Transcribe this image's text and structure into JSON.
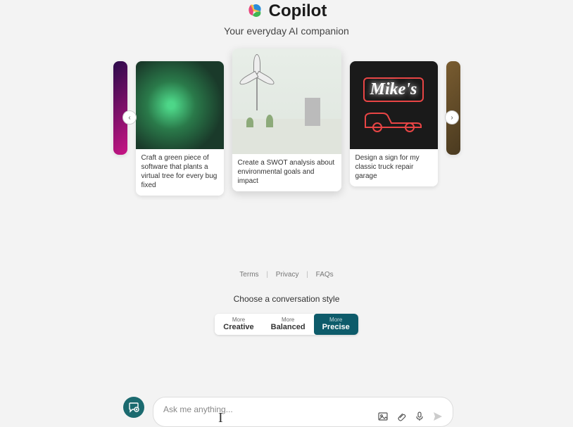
{
  "header": {
    "title": "Copilot",
    "subtitle": "Your everyday AI companion"
  },
  "carousel": {
    "nav_left": "‹",
    "nav_right": "›",
    "cards": [
      {
        "caption": ""
      },
      {
        "caption": "Craft a green piece of software that plants a virtual tree for every bug fixed"
      },
      {
        "caption": "Create a SWOT analysis about environmental goals and impact"
      },
      {
        "caption": "Design a sign for my classic truck repair garage",
        "brand": "Mike's"
      },
      {
        "caption": ""
      }
    ]
  },
  "footer": {
    "links": [
      "Terms",
      "Privacy",
      "FAQs"
    ]
  },
  "style": {
    "title": "Choose a conversation style",
    "options": [
      {
        "top": "More",
        "bot": "Creative"
      },
      {
        "top": "More",
        "bot": "Balanced"
      },
      {
        "top": "More",
        "bot": "Precise"
      }
    ],
    "active_index": 2
  },
  "input": {
    "placeholder": "Ask me anything...",
    "value": ""
  }
}
